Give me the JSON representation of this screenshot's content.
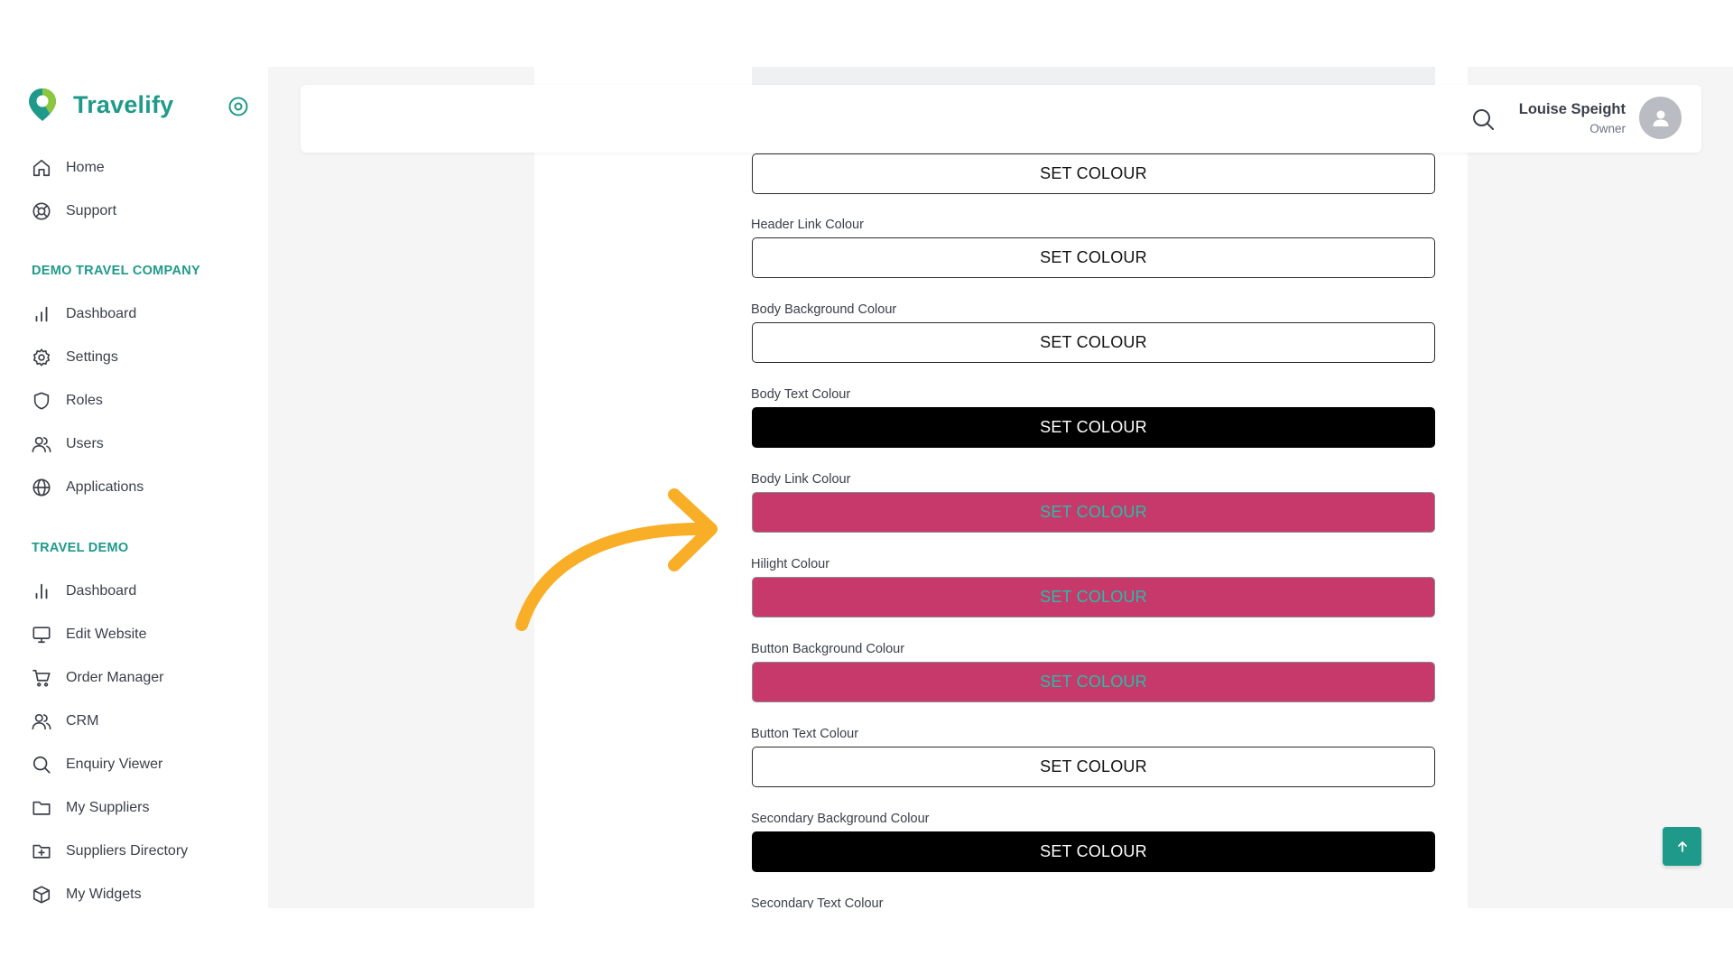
{
  "app": {
    "name": "Travelify"
  },
  "sidebar": {
    "main_items": [
      {
        "label": "Home",
        "icon": "home-icon"
      },
      {
        "label": "Support",
        "icon": "lifebuoy-icon"
      }
    ],
    "section1": {
      "title": "DEMO TRAVEL COMPANY",
      "items": [
        {
          "label": "Dashboard",
          "icon": "bar-chart-icon"
        },
        {
          "label": "Settings",
          "icon": "gear-icon"
        },
        {
          "label": "Roles",
          "icon": "shield-icon"
        },
        {
          "label": "Users",
          "icon": "users-icon"
        },
        {
          "label": "Applications",
          "icon": "globe-icon"
        }
      ]
    },
    "section2": {
      "title": "TRAVEL DEMO",
      "items": [
        {
          "label": "Dashboard",
          "icon": "bar-chart-icon"
        },
        {
          "label": "Edit Website",
          "icon": "monitor-icon"
        },
        {
          "label": "Order Manager",
          "icon": "cart-icon"
        },
        {
          "label": "CRM",
          "icon": "users-icon"
        },
        {
          "label": "Enquiry Viewer",
          "icon": "search-icon"
        },
        {
          "label": "My Suppliers",
          "icon": "folder-icon"
        },
        {
          "label": "Suppliers Directory",
          "icon": "folder-plus-icon"
        },
        {
          "label": "My Widgets",
          "icon": "box-icon"
        }
      ]
    }
  },
  "user": {
    "name": "Louise Speight",
    "role": "Owner"
  },
  "colour_fields": [
    {
      "label": "",
      "button": "SET COLOUR",
      "swatch": "#ffffff"
    },
    {
      "label": "Header Link Colour",
      "button": "SET COLOUR",
      "swatch": "#ffffff"
    },
    {
      "label": "Body Background Colour",
      "button": "SET COLOUR",
      "swatch": "#ffffff"
    },
    {
      "label": "Body Text Colour",
      "button": "SET COLOUR",
      "swatch": "#000000"
    },
    {
      "label": "Body Link Colour",
      "button": "SET COLOUR",
      "swatch": "#c7396a"
    },
    {
      "label": "Hilight Colour",
      "button": "SET COLOUR",
      "swatch": "#c7396a"
    },
    {
      "label": "Button Background Colour",
      "button": "SET COLOUR",
      "swatch": "#c7396a"
    },
    {
      "label": "Button Text Colour",
      "button": "SET COLOUR",
      "swatch": "#ffffff"
    },
    {
      "label": "Secondary Background Colour",
      "button": "SET COLOUR",
      "swatch": "#000000"
    },
    {
      "label": "Secondary Text Colour",
      "button": "",
      "swatch": ""
    }
  ],
  "colors": {
    "brand": "#1f9a8a",
    "accent_pink": "#c7396a",
    "annotation_arrow": "#f9ae28"
  }
}
